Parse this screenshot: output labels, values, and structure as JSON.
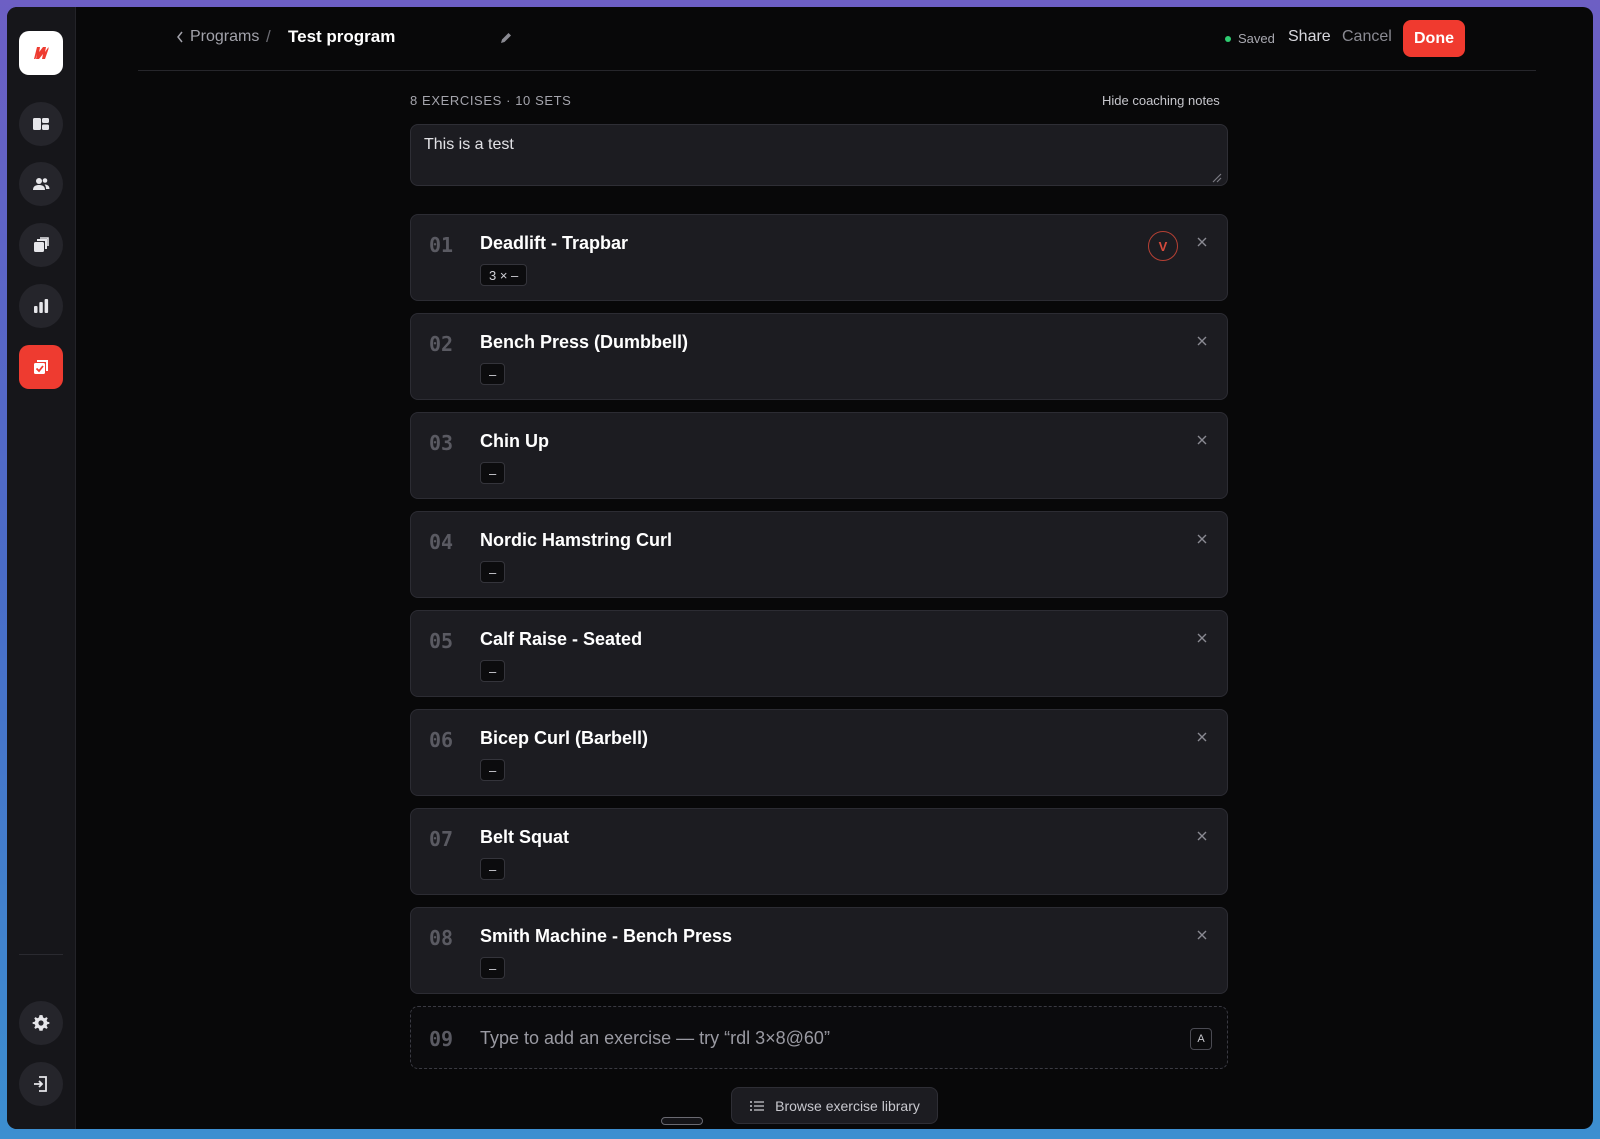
{
  "header": {
    "breadcrumb_parent": "Programs",
    "breadcrumb_separator": "/",
    "title": "Test program",
    "status": "Saved",
    "share_label": "Share",
    "cancel_label": "Cancel",
    "done_label": "Done"
  },
  "sidebar": {
    "items": [
      {
        "icon": "logo-icon"
      },
      {
        "icon": "dashboard-icon"
      },
      {
        "icon": "users-icon"
      },
      {
        "icon": "library-icon"
      },
      {
        "icon": "analytics-icon"
      },
      {
        "icon": "programs-icon",
        "active": true
      }
    ],
    "bottom": [
      {
        "icon": "gear-icon"
      },
      {
        "icon": "logout-icon"
      }
    ]
  },
  "summary": {
    "counts": "8 EXERCISES · 10 SETS",
    "hide_notes_label": "Hide coaching notes"
  },
  "notes": {
    "value": "This is a test"
  },
  "exercises": [
    {
      "num": "01",
      "name": "Deadlift - Trapbar",
      "chip": "3 × –",
      "badge": "V"
    },
    {
      "num": "02",
      "name": "Bench Press (Dumbbell)",
      "chip": "–"
    },
    {
      "num": "03",
      "name": "Chin Up",
      "chip": "–"
    },
    {
      "num": "04",
      "name": "Nordic Hamstring Curl",
      "chip": "–"
    },
    {
      "num": "05",
      "name": "Calf Raise - Seated",
      "chip": "–"
    },
    {
      "num": "06",
      "name": "Bicep Curl (Barbell)",
      "chip": "–"
    },
    {
      "num": "07",
      "name": "Belt Squat",
      "chip": "–"
    },
    {
      "num": "08",
      "name": "Smith Machine - Bench Press",
      "chip": "–"
    }
  ],
  "add_exercise": {
    "num": "09",
    "placeholder": "Type to add an exercise — try “rdl 3×8@60”",
    "shortcut": "A"
  },
  "browse_label": "Browse exercise library",
  "colors": {
    "accent": "#f03a2f",
    "saved": "#2ecc71",
    "card_bg": "#1c1c21"
  }
}
